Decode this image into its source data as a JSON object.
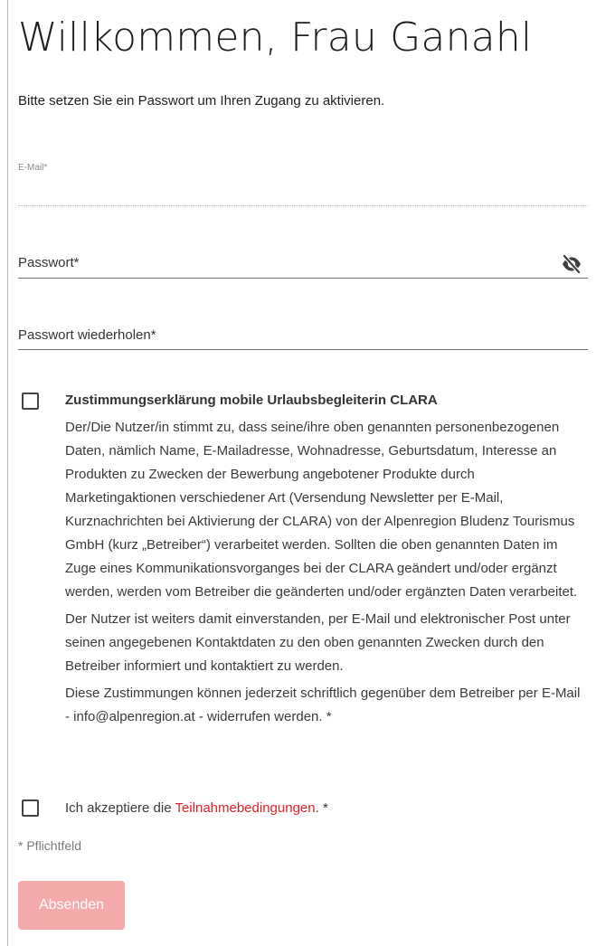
{
  "page": {
    "title": "Willkommen, Frau Ganahl",
    "intro": "Bitte setzen Sie ein Passwort um Ihren Zugang zu aktivieren."
  },
  "form": {
    "email": {
      "label": "E-Mail*",
      "value": ""
    },
    "password": {
      "label": "Passwort*",
      "value": "",
      "toggle_icon": "eye-off-icon"
    },
    "password_repeat": {
      "label": "Passwort wiederholen*",
      "value": ""
    },
    "consent": {
      "checked": false,
      "title": "Zustimmungserklärung mobile Urlaubsbegleiterin CLARA",
      "paragraphs": [
        "Der/Die Nutzer/in stimmt zu, dass seine/ihre oben genannten personenbezogenen Daten, nämlich Name, E-Mailadresse, Wohnadresse, Geburtsdatum, Interesse an Produkten zu Zwecken der Bewerbung angebotener Produkte durch Marketingaktionen verschiedener Art (Versendung Newsletter per E-Mail, Kurznachrichten bei Aktivierung der CLARA) von der Alpenregion Bludenz Tourismus GmbH (kurz „Betreiber“) verarbeitet werden. Sollten die oben genannten Daten im Zuge eines Kommunikationsvorganges bei der CLARA geändert und/oder ergänzt werden, werden vom Betreiber die geänderten und/oder ergänzten Daten verarbeitet.",
        "Der Nutzer ist weiters damit einverstanden, per E-Mail und elektronischer Post unter seinen angegebenen Kontaktdaten zu den oben genannten Zwecken durch den Betreiber informiert und kontaktiert zu werden.",
        "Diese Zustimmungen können jederzeit schriftlich gegenüber dem Betreiber per E-Mail - info@alpenregion.at - widerrufen werden. *"
      ]
    },
    "terms": {
      "checked": false,
      "prefix": "Ich akzeptiere die ",
      "link_text": "Teilnahmebedingungen",
      "suffix": ". *"
    },
    "required_note": "* Pflichtfeld",
    "submit_label": "Absenden"
  },
  "colors": {
    "link": "#e0202a",
    "submit_bg": "#f4a9ab",
    "submit_text": "#ffffff"
  }
}
